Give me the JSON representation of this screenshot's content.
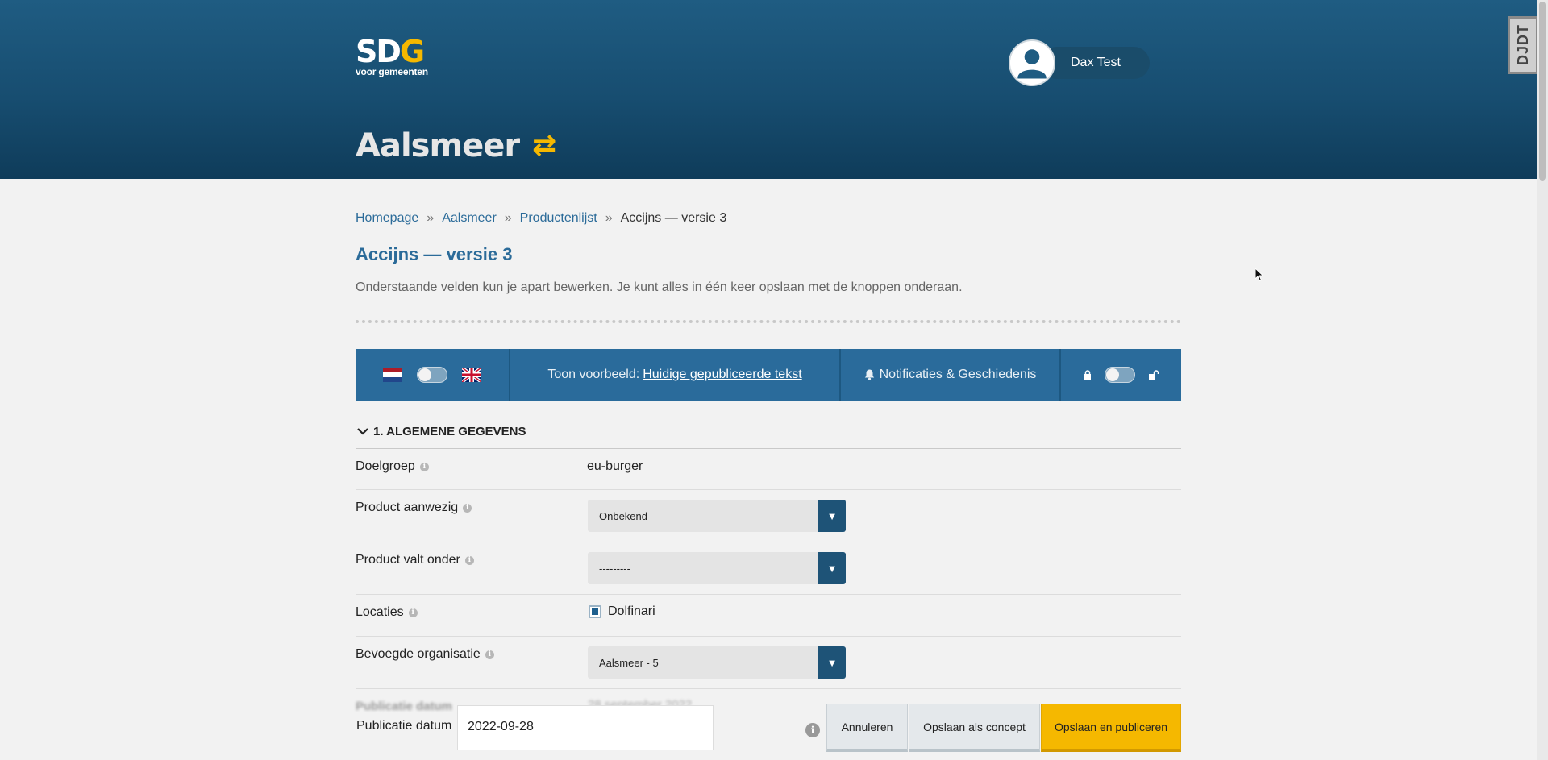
{
  "header": {
    "logo_main": "SD",
    "logo_accent": "G",
    "logo_sub": "voor gemeenten",
    "user_name": "Dax Test",
    "municipality": "Aalsmeer",
    "debug_toolbar_label": "DJDT"
  },
  "breadcrumb": [
    {
      "label": "Homepage"
    },
    {
      "label": "Aalsmeer"
    },
    {
      "label": "Productenlijst"
    },
    {
      "label": "Accijns — versie 3"
    }
  ],
  "breadcrumb_separator": "»",
  "page": {
    "title": "Accijns — versie 3",
    "intro": "Onderstaande velden kun je apart bewerken. Je kunt alles in één keer opslaan met de knoppen onderaan."
  },
  "toolbar": {
    "preview_prefix": "Toon voorbeeld:",
    "preview_link": "Huidige gepubliceerde tekst",
    "notifications": "Notificaties & Geschiedenis"
  },
  "section": {
    "title": "1. ALGEMENE GEGEVENS"
  },
  "fields": {
    "doelgroep": {
      "label": "Doelgroep",
      "value": "eu-burger"
    },
    "product_aanwezig": {
      "label": "Product aanwezig",
      "value": "Onbekend"
    },
    "product_valt_onder": {
      "label": "Product valt onder",
      "value": "---------"
    },
    "locaties": {
      "label": "Locaties",
      "value": "Dolfinari"
    },
    "bevoegde_organisatie": {
      "label": "Bevoegde organisatie",
      "value": "Aalsmeer - 5"
    }
  },
  "footer": {
    "blurred_label": "Publicatie datum",
    "blurred_value": "28 september 2022",
    "pub_label": "Publicatie datum",
    "pub_value": "2022-09-28",
    "cancel": "Annuleren",
    "save_concept": "Opslaan als concept",
    "save_publish": "Opslaan en publiceren"
  },
  "icons": {
    "switch": "⇄",
    "info": "i",
    "select_arrow": "▼"
  },
  "colors": {
    "header_bg": "#1f5c82",
    "accent_yellow": "#f5b800",
    "link_blue": "#2b6b99",
    "toolbar_bg": "#2a6b9b"
  }
}
